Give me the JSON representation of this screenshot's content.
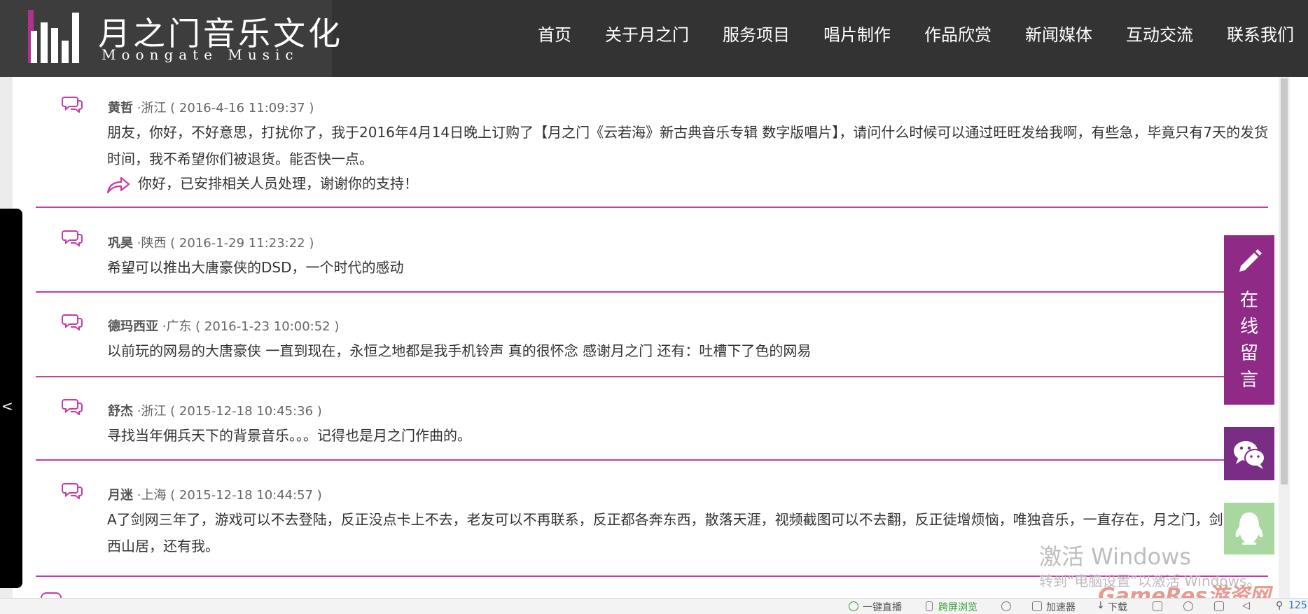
{
  "brand": {
    "title": "月之门音乐文化",
    "subtitle": "Moongate Music"
  },
  "nav": [
    "首页",
    "关于月之门",
    "服务项目",
    "唱片制作",
    "作品欣赏",
    "新闻媒体",
    "互动交流",
    "联系我们"
  ],
  "messages": [
    {
      "name": "黄哲",
      "meta": " ·浙江 ( 2016-4-16 11:09:37 )",
      "body": "朋友，你好，不好意思，打扰你了，我于2016年4月14日晚上订购了【月之门《云若海》新古典音乐专辑 数字版唱片】，请问什么时候可以通过旺旺发给我啊，有些急，毕竟只有7天的发货时间，我不希望你们被退货。能否快一点。",
      "reply": "你好，已安排相关人员处理，谢谢你的支持！"
    },
    {
      "name": "巩昊",
      "meta": " ·陕西 ( 2016-1-29 11:23:22 )",
      "body": "希望可以推出大唐豪侠的DSD，一个时代的感动"
    },
    {
      "name": "德玛西亚",
      "meta": " ·广东 ( 2016-1-23 10:00:52 )",
      "body": "以前玩的网易的大唐豪侠 一直到现在，永恒之地都是我手机铃声 真的很怀念 感谢月之门 还有：吐槽下了色的网易"
    },
    {
      "name": "舒杰",
      "meta": " ·浙江 ( 2015-12-18 10:45:36 )",
      "body": "寻找当年佣兵天下的背景音乐。。。记得也是月之门作曲的。"
    },
    {
      "name": "月迷",
      "meta": " ·上海 ( 2015-12-18 10:44:57 )",
      "body": "A了剑网三年了，游戏可以不去登陆，反正没点卡上不去，老友可以不再联系，反正都各奔东西，散落天涯，视频截图可以不去翻，反正徒增烦恼，唯独音乐，一直存在，月之门，剑网三，西山居，还有我。"
    }
  ],
  "side_tab": {
    "arrow": "<"
  },
  "float": {
    "message_label": "在线留言"
  },
  "watermark": {
    "line1": "激活 Windows",
    "line2": "转到“电脑设置”以激活 Windows。",
    "site": "GameRes游资网"
  },
  "statusbar": {
    "live": "一键直播",
    "cross_screen": "跨屏浏览",
    "accelerator": "加速器",
    "download": "下载",
    "zoom": "125"
  },
  "colors": {
    "header_bg": "#333333",
    "accent": "#c43ca8",
    "float_purple": "#8f2a86",
    "wechat_bg": "#7a2d84",
    "qq_bg": "#a8d8a0"
  },
  "icons": [
    "comment-icon",
    "reply-arrow-icon",
    "pencil-icon",
    "wechat-icon",
    "qq-icon"
  ]
}
